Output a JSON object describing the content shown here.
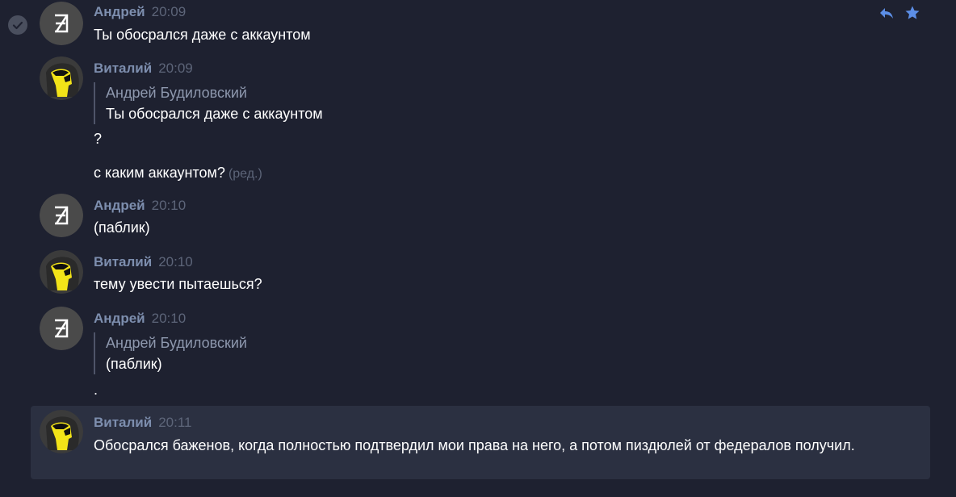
{
  "colors": {
    "background": "#1e2130",
    "selected_row": "#2b3041",
    "author": "#7d8eae",
    "timestamp": "#5d6579",
    "text": "#ffffff",
    "action_icon": "#5c8ee6"
  },
  "actions": {
    "reply_icon": "reply-icon",
    "star_icon": "star-icon"
  },
  "messages": [
    {
      "author": "Андрей",
      "time": "20:09",
      "text": "Ты обосрался даже с аккаунтом"
    },
    {
      "author": "Виталий",
      "time": "20:09",
      "quote": {
        "author": "Андрей Будиловский",
        "text": "Ты обосрался даже с аккаунтом"
      },
      "lines": [
        "?",
        "с каким аккаунтом?"
      ],
      "edited": "(ред.)"
    },
    {
      "author": "Андрей",
      "time": "20:10",
      "text": "(паблик)"
    },
    {
      "author": "Виталий",
      "time": "20:10",
      "text": "тему увести пытаешься?"
    },
    {
      "author": "Андрей",
      "time": "20:10",
      "quote": {
        "author": "Андрей Будиловский",
        "text": "(паблик)"
      },
      "text": "."
    },
    {
      "author": "Виталий",
      "time": "20:11",
      "text": "Обосрался баженов, когда полностью подтвердил мои права на него, а потом пиздюлей от федералов получил."
    }
  ]
}
